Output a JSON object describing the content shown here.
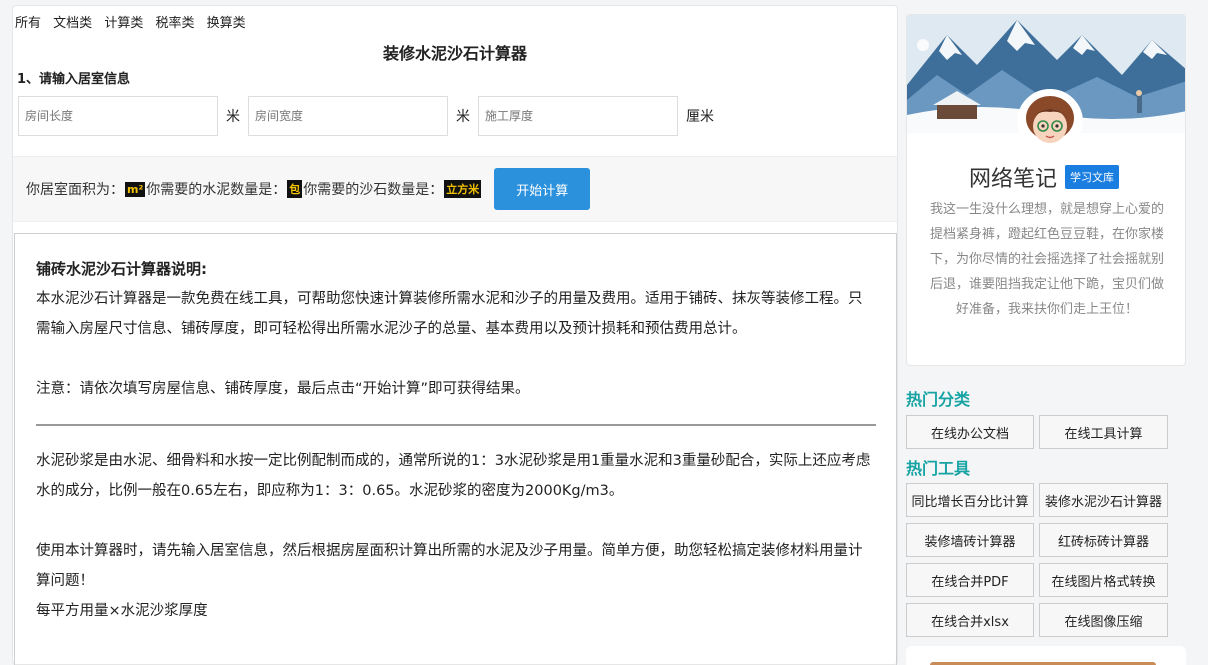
{
  "nav": [
    "所有",
    "文档类",
    "计算类",
    "税率类",
    "换算类"
  ],
  "title": "装修水泥沙石计算器",
  "section1": "1、请输入居室信息",
  "inputs": {
    "length_placeholder": "房间长度",
    "width_placeholder": "房间宽度",
    "thickness_placeholder": "施工厚度",
    "unit_m": "米",
    "unit_cm": "厘米"
  },
  "result": {
    "area_label": "你居室面积为：",
    "area_unit": "m²",
    "cement_label": "你需要的水泥数量是：",
    "cement_unit": "包",
    "sand_label": " 你需要的沙石数量是：",
    "sand_unit": "立方米",
    "button": "开始计算"
  },
  "description": {
    "heading": "铺砖水泥沙石计算器说明:",
    "p1": "本水泥沙石计算器是一款免费在线工具，可帮助您快速计算装修所需水泥和沙子的用量及费用。适用于铺砖、抹灰等装修工程。只需输入房屋尺寸信息、铺砖厚度，即可轻松得出所需水泥沙子的总量、基本费用以及预计损耗和预估费用总计。",
    "note": "注意：请依次填写房屋信息、铺砖厚度，最后点击“开始计算”即可获得结果。",
    "p2": "水泥砂浆是由水泥、细骨料和水按一定比例配制而成的，通常所说的1：3水泥砂浆是用1重量水泥和3重量砂配合，实际上还应考虑水的成分，比例一般在0.65左右，即应称为1：3：0.65。水泥砂浆的密度为2000Kg/m3。",
    "p3": "使用本计算器时，请先输入居室信息，然后根据房屋面积计算出所需的水泥及沙子用量。简单方便，助您轻松搞定装修材料用量计算问题！",
    "formula": "每平方用量×水泥沙浆厚度"
  },
  "profile": {
    "name": "网络笔记",
    "tag": "学习文库",
    "motto": "我这一生没什么理想，就是想穿上心爱的提档紧身裤，蹬起红色豆豆鞋，在你家楼下，为你尽情的社会摇选择了社会摇就别后退，谁要阻挡我定让他下跪，宝贝们做好准备，我来扶你们走上王位！"
  },
  "hot_categories": {
    "heading": "热门分类",
    "items": [
      "在线办公文档",
      "在线工具计算"
    ]
  },
  "hot_tools": {
    "heading": "热门工具",
    "items": [
      "同比增长百分比计算",
      "装修水泥沙石计算器",
      "装修墙砖计算器",
      "红砖标砖计算器",
      "在线合并PDF",
      "在线图片格式转换",
      "在线合并xlsx",
      "在线图像压缩"
    ]
  }
}
